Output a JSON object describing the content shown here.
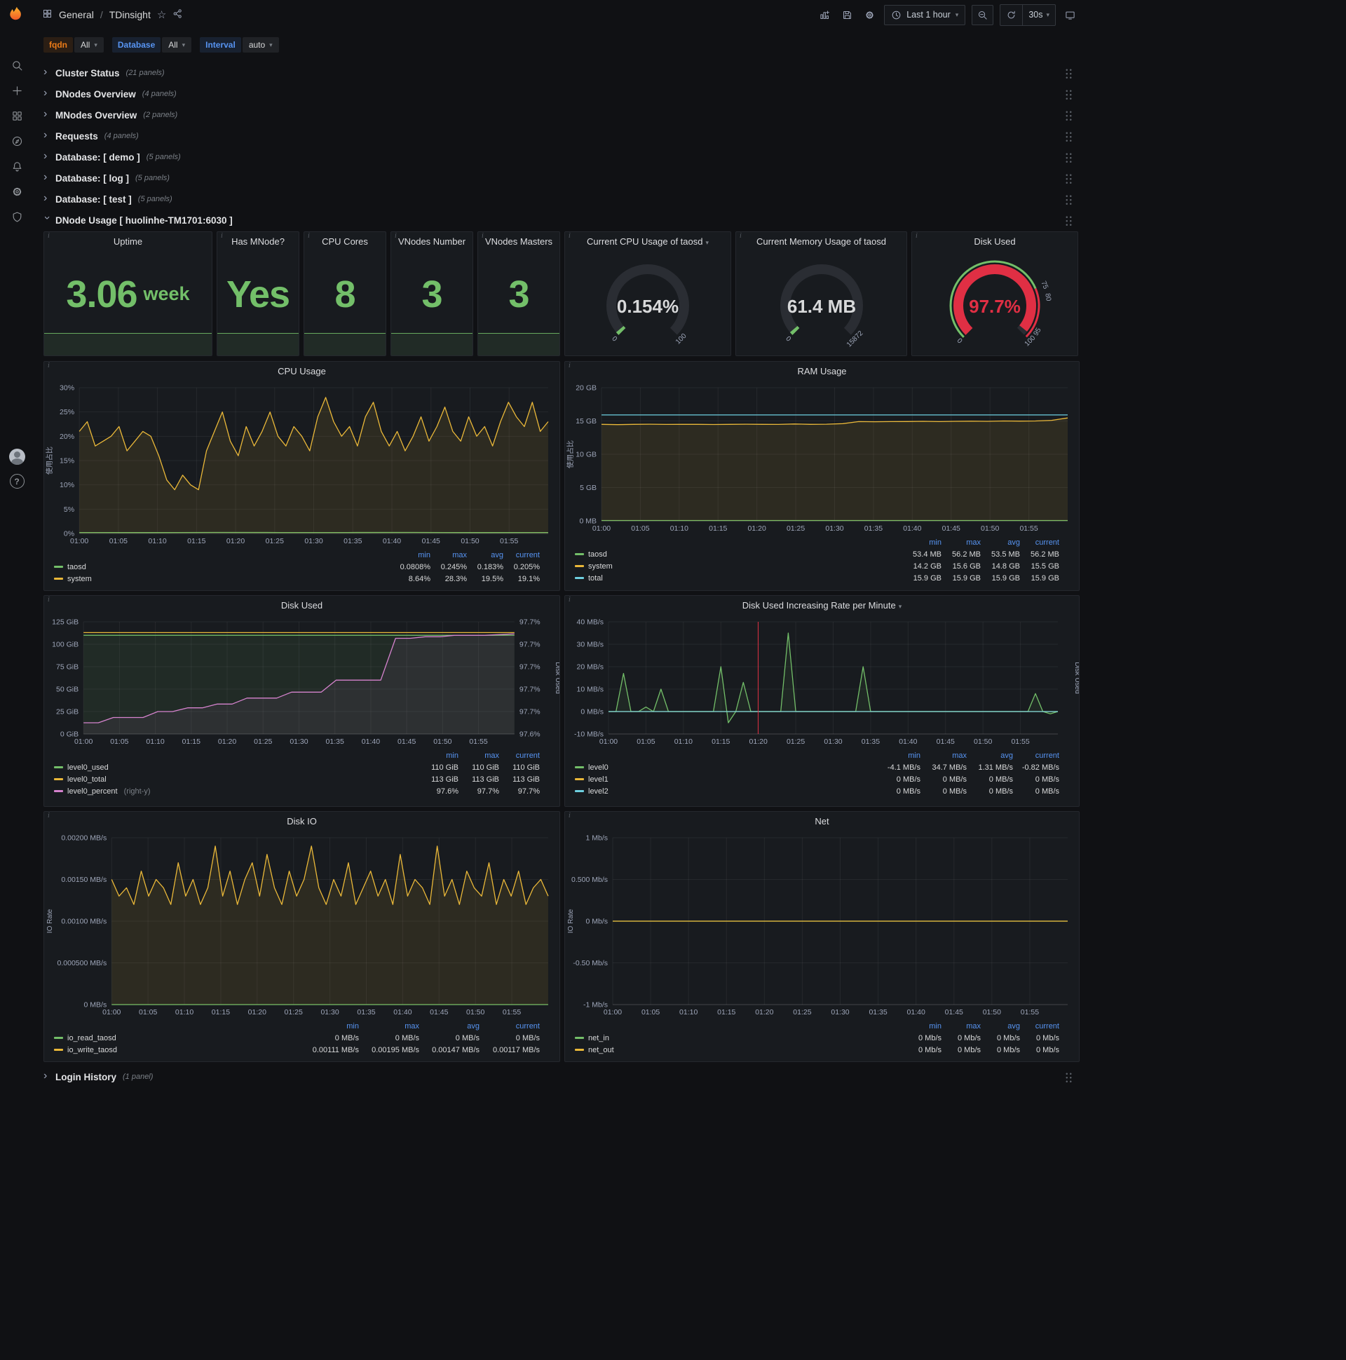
{
  "topnav": {
    "breadcrumb": {
      "section": "General",
      "separator": "/",
      "title": "TDinsight"
    },
    "time_range_label": "Last 1 hour",
    "refresh_interval_label": "30s"
  },
  "variables": [
    {
      "label": "fqdn",
      "value": "All",
      "accent": "orange"
    },
    {
      "label": "Database",
      "value": "All",
      "accent": "blue"
    },
    {
      "label": "Interval",
      "value": "auto",
      "accent": "blue"
    }
  ],
  "collapsed_rows": [
    {
      "title": "Cluster Status",
      "count": "(21 panels)"
    },
    {
      "title": "DNodes Overview",
      "count": "(4 panels)"
    },
    {
      "title": "MNodes Overview",
      "count": "(2 panels)"
    },
    {
      "title": "Requests",
      "count": "(4 panels)"
    },
    {
      "title": "Database: [ demo ]",
      "count": "(5 panels)"
    },
    {
      "title": "Database: [ log ]",
      "count": "(5 panels)"
    },
    {
      "title": "Database: [ test ]",
      "count": "(5 panels)"
    }
  ],
  "expanded_row": {
    "title": "DNode Usage [ huolinhe-TM1701:6030 ]"
  },
  "bottom_row": {
    "title": "Login History",
    "count": "(1 panel)"
  },
  "stats": [
    {
      "title": "Uptime",
      "value": "3.06",
      "suffix": "week"
    },
    {
      "title": "Has MNode?",
      "value": "Yes",
      "suffix": ""
    },
    {
      "title": "CPU Cores",
      "value": "8",
      "suffix": ""
    },
    {
      "title": "VNodes Number",
      "value": "3",
      "suffix": ""
    },
    {
      "title": "VNodes Masters",
      "value": "3",
      "suffix": ""
    }
  ],
  "gauges": [
    {
      "id": "cpu-gauge",
      "title": "Current CPU Usage of taosd",
      "title_caret": true,
      "value": "0.154%",
      "min_label": "0",
      "max_label": "100",
      "fraction": 0.00154,
      "arc_color": "#73bf69",
      "value_color": "#d8d9da",
      "thresholds": []
    },
    {
      "id": "mem-gauge",
      "title": "Current Memory Usage of taosd",
      "title_caret": false,
      "value": "61.4 MB",
      "min_label": "0",
      "max_label": "15872",
      "fraction": 0.0039,
      "arc_color": "#73bf69",
      "value_color": "#d8d9da",
      "thresholds": []
    },
    {
      "id": "disk-gauge",
      "title": "Disk Used",
      "title_caret": false,
      "value": "97.7%",
      "min_label": "0",
      "max_label": "",
      "fraction": 0.977,
      "arc_color": "#e02f44",
      "value_color": "#e02f44",
      "thresholds": [
        {
          "label": "75",
          "at": 0.75
        },
        {
          "label": "80",
          "at": 0.8
        },
        {
          "label": "95",
          "at": 0.95
        },
        {
          "label": "100",
          "at": 1.0
        }
      ]
    }
  ],
  "colors": {
    "green": "#73bf69",
    "yellow": "#eab839",
    "blue": "#6ed0e0",
    "pink": "#d683ce",
    "red": "#e02f44",
    "link": "#5794f2",
    "orange": "#eb7b18"
  },
  "chart_data": [
    {
      "id": "cpu",
      "type": "line",
      "title": "CPU Usage",
      "title_caret": false,
      "ylabel": "使用占比",
      "ylim": [
        0,
        30
      ],
      "yticks": [
        "0%",
        "5%",
        "10%",
        "15%",
        "20%",
        "25%",
        "30%"
      ],
      "x_labels": [
        "01:00",
        "01:05",
        "01:10",
        "01:15",
        "01:20",
        "01:25",
        "01:30",
        "01:35",
        "01:40",
        "01:45",
        "01:50",
        "01:55"
      ],
      "series": [
        {
          "name": "taosd",
          "color": "green",
          "fill": 0.08,
          "values": [
            0.2,
            0.19,
            0.21,
            0.2,
            0.2,
            0.21,
            0.19,
            0.2
          ]
        },
        {
          "name": "system",
          "color": "yellow",
          "fill": 0.1,
          "values": [
            21,
            23,
            18,
            19,
            20,
            22,
            17,
            19,
            21,
            20,
            16,
            11,
            9,
            12,
            10,
            9,
            17,
            21,
            25,
            19,
            16,
            22,
            18,
            21,
            25,
            20,
            18,
            22,
            20,
            17,
            24,
            28,
            23,
            20,
            22,
            18,
            24,
            27,
            21,
            18,
            21,
            17,
            20,
            24,
            19,
            22,
            26,
            21,
            19,
            24,
            20,
            22,
            18,
            23,
            27,
            24,
            22,
            27,
            21,
            23
          ]
        }
      ],
      "legend": {
        "cols": [
          "min",
          "max",
          "avg",
          "current"
        ],
        "rows": [
          {
            "name": "taosd",
            "color": "green",
            "values": [
              "0.0808%",
              "0.245%",
              "0.183%",
              "0.205%"
            ]
          },
          {
            "name": "system",
            "color": "yellow",
            "values": [
              "8.64%",
              "28.3%",
              "19.5%",
              "19.1%"
            ]
          }
        ]
      }
    },
    {
      "id": "ram",
      "type": "line",
      "title": "RAM Usage",
      "title_caret": false,
      "ylabel": "使用占比",
      "ylim": [
        0,
        20
      ],
      "yticks": [
        "0 MB",
        "5 GB",
        "10 GB",
        "15 GB",
        "20 GB"
      ],
      "x_labels": [
        "01:00",
        "01:05",
        "01:10",
        "01:15",
        "01:20",
        "01:25",
        "01:30",
        "01:35",
        "01:40",
        "01:45",
        "01:50",
        "01:55"
      ],
      "series": [
        {
          "name": "taosd",
          "color": "green",
          "values": [
            0.05,
            0.05
          ]
        },
        {
          "name": "system",
          "color": "yellow",
          "fill": 0.1,
          "values": [
            14.5,
            14.45,
            14.5,
            14.52,
            14.48,
            14.5,
            14.5,
            14.47,
            14.5,
            14.52,
            14.5,
            14.48,
            14.55,
            14.5,
            14.52,
            14.6,
            14.9,
            14.88,
            14.9,
            14.92,
            14.95,
            14.9,
            14.95,
            14.97,
            14.95,
            15.0,
            14.98,
            15.0,
            15.1,
            15.45
          ]
        },
        {
          "name": "total",
          "color": "blue",
          "values": [
            15.9,
            15.9
          ]
        }
      ],
      "legend": {
        "cols": [
          "min",
          "max",
          "avg",
          "current"
        ],
        "rows": [
          {
            "name": "taosd",
            "color": "green",
            "values": [
              "53.4 MB",
              "56.2 MB",
              "53.5 MB",
              "56.2 MB"
            ]
          },
          {
            "name": "system",
            "color": "yellow",
            "values": [
              "14.2 GB",
              "15.6 GB",
              "14.8 GB",
              "15.5 GB"
            ]
          },
          {
            "name": "total",
            "color": "blue",
            "values": [
              "15.9 GB",
              "15.9 GB",
              "15.9 GB",
              "15.9 GB"
            ]
          }
        ]
      }
    },
    {
      "id": "disk_used",
      "type": "line",
      "title": "Disk Used",
      "title_caret": false,
      "ylim": [
        0,
        125
      ],
      "yticks": [
        "0 GiB",
        "25 GiB",
        "50 GiB",
        "75 GiB",
        "100 GiB",
        "125 GiB"
      ],
      "ylim_right": [
        97.58,
        97.73
      ],
      "yticks_right": [
        "97.6%",
        "97.7%",
        "97.7%",
        "97.7%",
        "97.7%",
        "97.7%"
      ],
      "ylabel_right": "Disk Used",
      "x_labels": [
        "01:00",
        "01:05",
        "01:10",
        "01:15",
        "01:20",
        "01:25",
        "01:30",
        "01:35",
        "01:40",
        "01:45",
        "01:50",
        "01:55"
      ],
      "series": [
        {
          "name": "level0_used",
          "color": "green",
          "fill": 0.1,
          "values": [
            110,
            110
          ]
        },
        {
          "name": "level0_total",
          "color": "yellow",
          "values": [
            113,
            113
          ]
        },
        {
          "name": "level0_percent",
          "color": "pink",
          "axis": "right",
          "fill": 0.07,
          "values": [
            97.595,
            97.595,
            97.602,
            97.602,
            97.602,
            97.61,
            97.61,
            97.615,
            97.615,
            97.62,
            97.62,
            97.628,
            97.628,
            97.628,
            97.636,
            97.636,
            97.636,
            97.652,
            97.652,
            97.652,
            97.652,
            97.708,
            97.708,
            97.71,
            97.71,
            97.712,
            97.712,
            97.712,
            97.713,
            97.714
          ]
        }
      ],
      "legend": {
        "cols": [
          "min",
          "max",
          "current"
        ],
        "rows": [
          {
            "name": "level0_used",
            "color": "green",
            "values": [
              "110 GiB",
              "110 GiB",
              "110 GiB"
            ]
          },
          {
            "name": "level0_total",
            "color": "yellow",
            "values": [
              "113 GiB",
              "113 GiB",
              "113 GiB"
            ]
          },
          {
            "name": "level0_percent",
            "note": "(right-y)",
            "color": "pink",
            "values": [
              "97.6%",
              "97.7%",
              "97.7%"
            ]
          }
        ]
      }
    },
    {
      "id": "disk_rate",
      "type": "line",
      "title": "Disk Used Increasing Rate per Minute",
      "title_caret": true,
      "ylim": [
        -10,
        40
      ],
      "yticks": [
        "-10 MB/s",
        "0 MB/s",
        "10 MB/s",
        "20 MB/s",
        "30 MB/s",
        "40 MB/s"
      ],
      "ylabel_right": "Disk Used",
      "annotation_frac": 0.333,
      "x_labels": [
        "01:00",
        "01:05",
        "01:10",
        "01:15",
        "01:20",
        "01:25",
        "01:30",
        "01:35",
        "01:40",
        "01:45",
        "01:50",
        "01:55"
      ],
      "series": [
        {
          "name": "level0",
          "color": "green",
          "fill": 0.08,
          "values": [
            0,
            0,
            17,
            0,
            0,
            2,
            0,
            10,
            0,
            0,
            0,
            0,
            0,
            0,
            0,
            20,
            -5,
            0,
            13,
            0,
            0,
            0,
            0,
            0,
            35,
            0,
            0,
            0,
            0,
            0,
            0,
            0,
            0,
            0,
            20,
            0,
            0,
            0,
            0,
            0,
            0,
            0,
            0,
            0,
            0,
            0,
            0,
            0,
            0,
            0,
            0,
            0,
            0,
            0,
            0,
            0,
            0,
            8,
            0,
            -1,
            0
          ]
        },
        {
          "name": "level1",
          "color": "yellow",
          "values": [
            0,
            0
          ]
        },
        {
          "name": "level2",
          "color": "blue",
          "values": [
            0,
            0
          ]
        }
      ],
      "legend": {
        "cols": [
          "min",
          "max",
          "avg",
          "current"
        ],
        "rows": [
          {
            "name": "level0",
            "color": "green",
            "values": [
              "-4.1 MB/s",
              "34.7 MB/s",
              "1.31 MB/s",
              "-0.82 MB/s"
            ]
          },
          {
            "name": "level1",
            "color": "yellow",
            "values": [
              "0 MB/s",
              "0 MB/s",
              "0 MB/s",
              "0 MB/s"
            ]
          },
          {
            "name": "level2",
            "color": "blue",
            "values": [
              "0 MB/s",
              "0 MB/s",
              "0 MB/s",
              "0 MB/s"
            ]
          }
        ]
      }
    },
    {
      "id": "disk_io",
      "type": "line",
      "title": "Disk IO",
      "title_caret": false,
      "ylabel": "IO Rate",
      "ylim": [
        0,
        0.002
      ],
      "yticks": [
        "0 MB/s",
        "0.000500 MB/s",
        "0.00100 MB/s",
        "0.00150 MB/s",
        "0.00200 MB/s"
      ],
      "x_labels": [
        "01:00",
        "01:05",
        "01:10",
        "01:15",
        "01:20",
        "01:25",
        "01:30",
        "01:35",
        "01:40",
        "01:45",
        "01:50",
        "01:55"
      ],
      "series": [
        {
          "name": "io_read_taosd",
          "color": "green",
          "values": [
            0,
            0
          ]
        },
        {
          "name": "io_write_taosd",
          "color": "yellow",
          "fill": 0.1,
          "values": [
            0.0015,
            0.0013,
            0.0014,
            0.0012,
            0.0016,
            0.0013,
            0.0015,
            0.0014,
            0.0012,
            0.0017,
            0.0013,
            0.0015,
            0.0012,
            0.0014,
            0.0019,
            0.0013,
            0.0016,
            0.0012,
            0.0015,
            0.0017,
            0.0013,
            0.0018,
            0.0014,
            0.0012,
            0.0016,
            0.0013,
            0.0015,
            0.0019,
            0.0014,
            0.0012,
            0.0015,
            0.0013,
            0.0017,
            0.0012,
            0.0014,
            0.0016,
            0.0013,
            0.0015,
            0.0012,
            0.0018,
            0.0013,
            0.0015,
            0.0014,
            0.0012,
            0.0019,
            0.0013,
            0.0015,
            0.0012,
            0.0016,
            0.0014,
            0.0013,
            0.0017,
            0.0012,
            0.0015,
            0.0013,
            0.0016,
            0.0012,
            0.0014,
            0.0015,
            0.0013
          ]
        }
      ],
      "legend": {
        "cols": [
          "min",
          "max",
          "avg",
          "current"
        ],
        "rows": [
          {
            "name": "io_read_taosd",
            "color": "green",
            "values": [
              "0 MB/s",
              "0 MB/s",
              "0 MB/s",
              "0 MB/s"
            ]
          },
          {
            "name": "io_write_taosd",
            "color": "yellow",
            "values": [
              "0.00111 MB/s",
              "0.00195 MB/s",
              "0.00147 MB/s",
              "0.00117 MB/s"
            ]
          }
        ]
      }
    },
    {
      "id": "net",
      "type": "line",
      "title": "Net",
      "title_caret": false,
      "ylabel": "IO Rate",
      "ylim": [
        -1,
        1
      ],
      "yticks": [
        "-1 Mb/s",
        "-0.50 Mb/s",
        "0 Mb/s",
        "0.500 Mb/s",
        "1 Mb/s"
      ],
      "x_labels": [
        "01:00",
        "01:05",
        "01:10",
        "01:15",
        "01:20",
        "01:25",
        "01:30",
        "01:35",
        "01:40",
        "01:45",
        "01:50",
        "01:55"
      ],
      "series": [
        {
          "name": "net_in",
          "color": "green",
          "values": [
            0,
            0
          ]
        },
        {
          "name": "net_out",
          "color": "yellow",
          "values": [
            0,
            0
          ]
        }
      ],
      "legend": {
        "cols": [
          "min",
          "max",
          "avg",
          "current"
        ],
        "rows": [
          {
            "name": "net_in",
            "color": "green",
            "values": [
              "0 Mb/s",
              "0 Mb/s",
              "0 Mb/s",
              "0 Mb/s"
            ]
          },
          {
            "name": "net_out",
            "color": "yellow",
            "values": [
              "0 Mb/s",
              "0 Mb/s",
              "0 Mb/s",
              "0 Mb/s"
            ]
          }
        ]
      }
    }
  ]
}
